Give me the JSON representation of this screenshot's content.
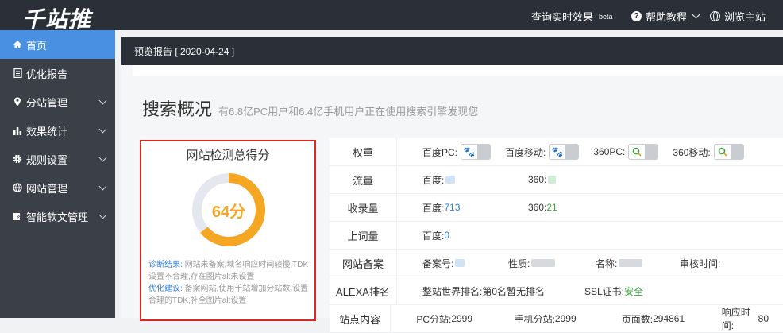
{
  "topbar": {
    "logo": "千站推",
    "query_label": "查询实时效果",
    "query_badge": "beta",
    "help_label": "帮助教程",
    "browse_label": "浏览主站"
  },
  "sidebar": {
    "items": [
      {
        "label": "首页",
        "icon": "home-icon"
      },
      {
        "label": "优化报告",
        "icon": "document-icon"
      },
      {
        "label": "分站管理",
        "icon": "location-pin-icon"
      },
      {
        "label": "效果统计",
        "icon": "bar-chart-icon"
      },
      {
        "label": "规则设置",
        "icon": "gear-icon"
      },
      {
        "label": "网站管理",
        "icon": "globe-icon"
      },
      {
        "label": "智能软文管理",
        "icon": "edit-icon"
      }
    ]
  },
  "report": {
    "title": "预览报告 [ 2020-04-24 ]"
  },
  "overview": {
    "title": "搜索概况",
    "subtitle": "有6.8亿PC用户和6.4亿手机用户正在使用搜索引擎发现您"
  },
  "score": {
    "title": "网站检测总得分",
    "value_label": "64分",
    "value": 64,
    "ring_color": "#f5a623",
    "diag_key": "诊断结果:",
    "diag_text": "网站未备案,域名响应时间较慢,TDK设置不合理,存在图片alt未设置",
    "advice_key": "优化建议:",
    "advice_text": "备案网站,使用千站增加分站数,设置合理的TDK,补全图片alt设置"
  },
  "table": {
    "rows": [
      {
        "header": "权重",
        "items": [
          {
            "label": "百度PC:"
          },
          {
            "label": "百度移动:"
          },
          {
            "label": "360PC:"
          },
          {
            "label": "360移动:"
          }
        ]
      },
      {
        "header": "流量",
        "items": [
          {
            "label": "百度:"
          },
          {
            "label": "360:"
          }
        ]
      },
      {
        "header": "收录量",
        "items": [
          {
            "label": "百度:",
            "value": "713"
          },
          {
            "label": "360:",
            "value": "21"
          }
        ]
      },
      {
        "header": "上词量",
        "items": [
          {
            "label": "百度:",
            "value": "0"
          }
        ]
      },
      {
        "header": "网站备案",
        "items": [
          {
            "label": "备案号:"
          },
          {
            "label": "性质:"
          },
          {
            "label": "名称:"
          },
          {
            "label": "审核时间:"
          }
        ]
      },
      {
        "header": "ALEXA排名",
        "items": [
          {
            "label": "整站世界排名:",
            "value": "第0名暂无排名"
          },
          {
            "label": "SSL证书:",
            "value": "安全"
          }
        ]
      },
      {
        "header": "站点内容",
        "items": [
          {
            "label": "PC分站:",
            "value": "2999"
          },
          {
            "label": "手机分站:",
            "value": "2999"
          },
          {
            "label": "页面数:",
            "value": "294861"
          },
          {
            "label": "响应时间:",
            "value": "80"
          }
        ]
      }
    ]
  }
}
